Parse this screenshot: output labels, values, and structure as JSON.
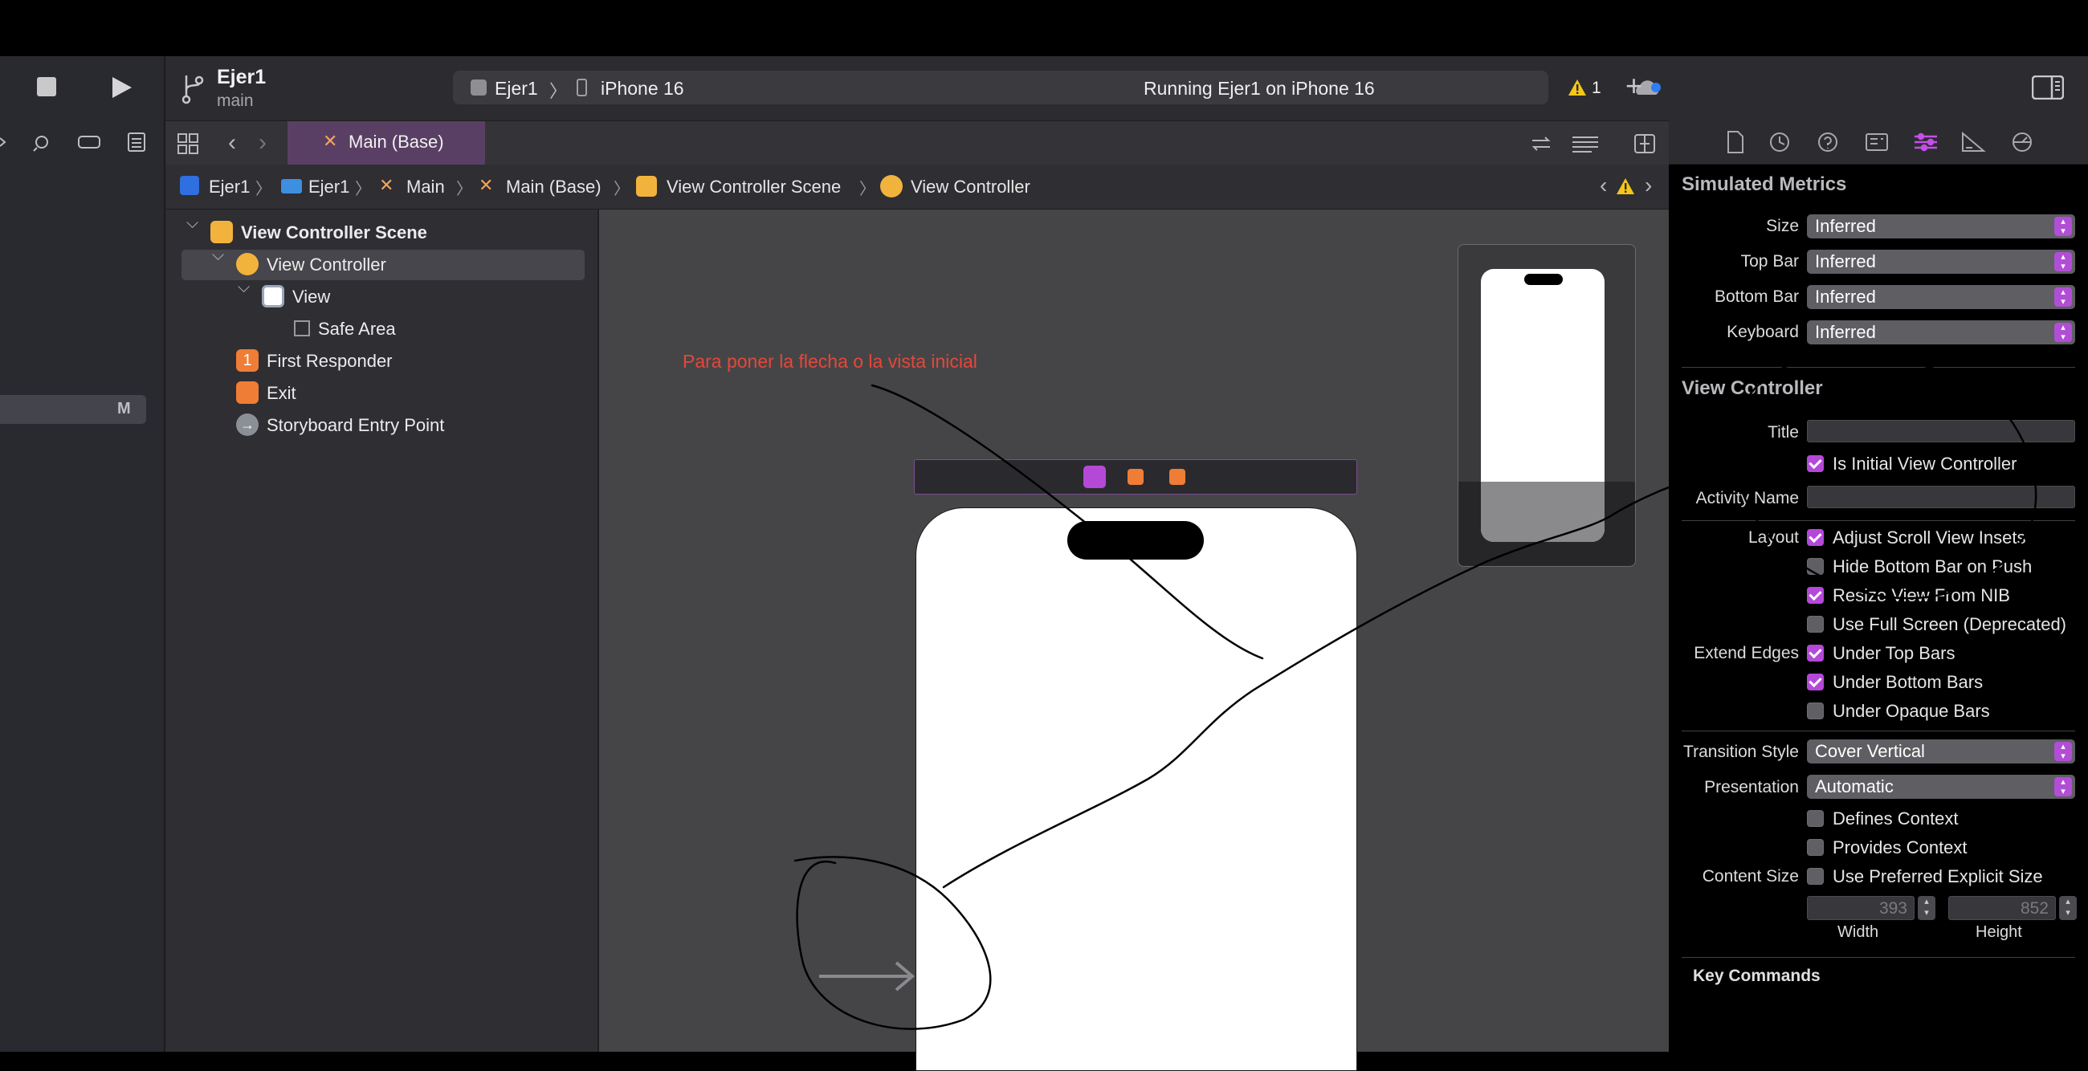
{
  "toolbar": {
    "project_name": "Ejer1",
    "branch": "main",
    "scheme": "Ejer1",
    "device": "iPhone 16",
    "status": "Running Ejer1 on iPhone 16",
    "warning_count": "1"
  },
  "left_panel": {
    "badge": "M"
  },
  "tab": {
    "label": "Main (Base)"
  },
  "breadcrumb": [
    "Ejer1",
    "Ejer1",
    "Main",
    "Main (Base)",
    "View Controller Scene",
    "View Controller"
  ],
  "outline": {
    "items": [
      {
        "label": "View Controller Scene"
      },
      {
        "label": "View Controller"
      },
      {
        "label": "View"
      },
      {
        "label": "Safe Area"
      },
      {
        "label": "First Responder"
      },
      {
        "label": "Exit"
      },
      {
        "label": "Storyboard Entry Point"
      }
    ]
  },
  "canvas": {
    "annotation": "Para poner la flecha o la vista inicial"
  },
  "inspector": {
    "simulated_metrics": {
      "title": "Simulated Metrics",
      "rows": [
        {
          "label": "Size",
          "value": "Inferred"
        },
        {
          "label": "Top Bar",
          "value": "Inferred"
        },
        {
          "label": "Bottom Bar",
          "value": "Inferred"
        },
        {
          "label": "Keyboard",
          "value": "Inferred"
        }
      ]
    },
    "view_controller": {
      "title": "View Controller",
      "title_label": "Title",
      "is_initial": "Is Initial View Controller",
      "activity_name_label": "Activity Name",
      "layout_label": "Layout",
      "layout_options": [
        {
          "label": "Adjust Scroll View Insets",
          "checked": true
        },
        {
          "label": "Hide Bottom Bar on Push",
          "checked": false
        },
        {
          "label": "Resize View From NIB",
          "checked": true
        },
        {
          "label": "Use Full Screen (Deprecated)",
          "checked": false
        }
      ],
      "extend_edges_label": "Extend Edges",
      "extend_edges": [
        {
          "label": "Under Top Bars",
          "checked": true
        },
        {
          "label": "Under Bottom Bars",
          "checked": true
        },
        {
          "label": "Under Opaque Bars",
          "checked": false
        }
      ],
      "transition_style_label": "Transition Style",
      "transition_style": "Cover Vertical",
      "presentation_label": "Presentation",
      "presentation": "Automatic",
      "defines_context": "Defines Context",
      "provides_context": "Provides Context",
      "content_size_label": "Content Size",
      "use_preferred": "Use Preferred Explicit Size",
      "width_value": "393",
      "height_value": "852",
      "width_label": "Width",
      "height_label": "Height"
    },
    "key_commands": "Key Commands"
  },
  "colors": {
    "accent": "#b449d8",
    "annotation": "#e5473a",
    "warning": "#f5c518"
  }
}
